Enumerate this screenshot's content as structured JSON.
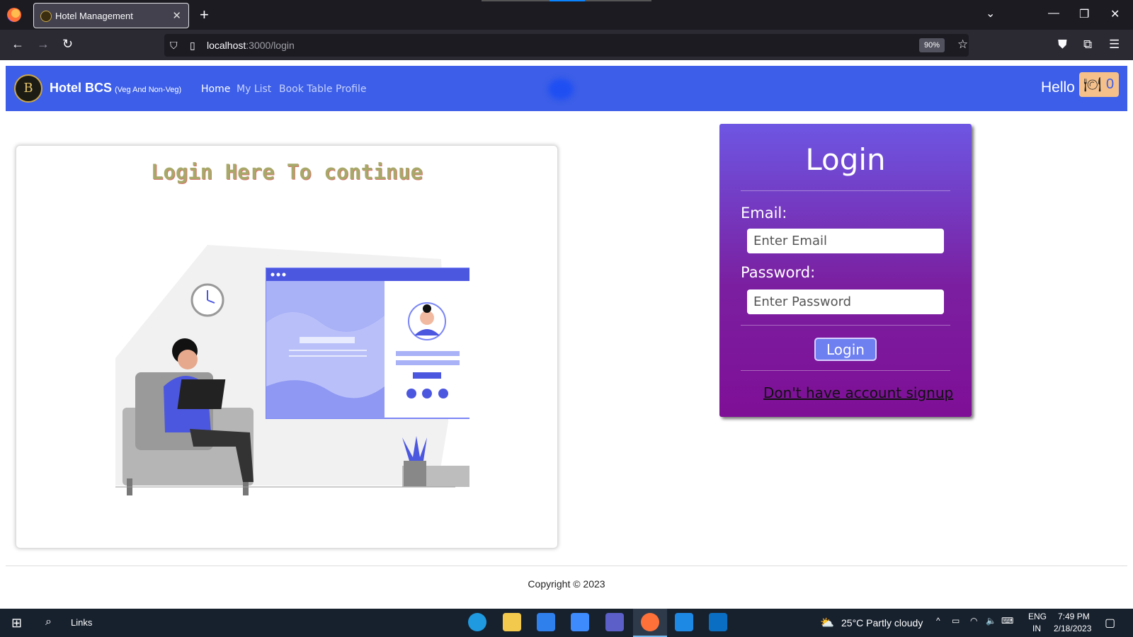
{
  "browser": {
    "tab_title": "Hotel Management",
    "url_host": "localhost",
    "url_rest": ":3000/login",
    "zoom": "90%"
  },
  "appbar": {
    "brand": "Hotel BCS",
    "brand_sub": "(Veg And Non-Veg)",
    "logo_letter": "B",
    "nav": [
      "Home",
      "My List",
      "Book Table",
      "Profile"
    ],
    "hello": "Hello",
    "cart_count": "0"
  },
  "left_card": {
    "heading": "Login Here To continue"
  },
  "login": {
    "title": "Login",
    "email_label": "Email:",
    "email_placeholder": "Enter Email",
    "password_label": "Password:",
    "password_placeholder": "Enter Password",
    "button": "Login",
    "signup_link": "Don't have account signup"
  },
  "footer": {
    "copyright": "Copyright © 2023"
  },
  "taskbar": {
    "search_label": "Links",
    "weather": "25°C  Partly cloudy",
    "lang_1": "ENG",
    "lang_2": "IN",
    "time": "7:49 PM",
    "date": "2/18/2023"
  },
  "colors": {
    "appbar": "#3c5ee8",
    "login_gradient_top": "#6d56e3",
    "login_gradient_bottom": "#7e0f96"
  }
}
